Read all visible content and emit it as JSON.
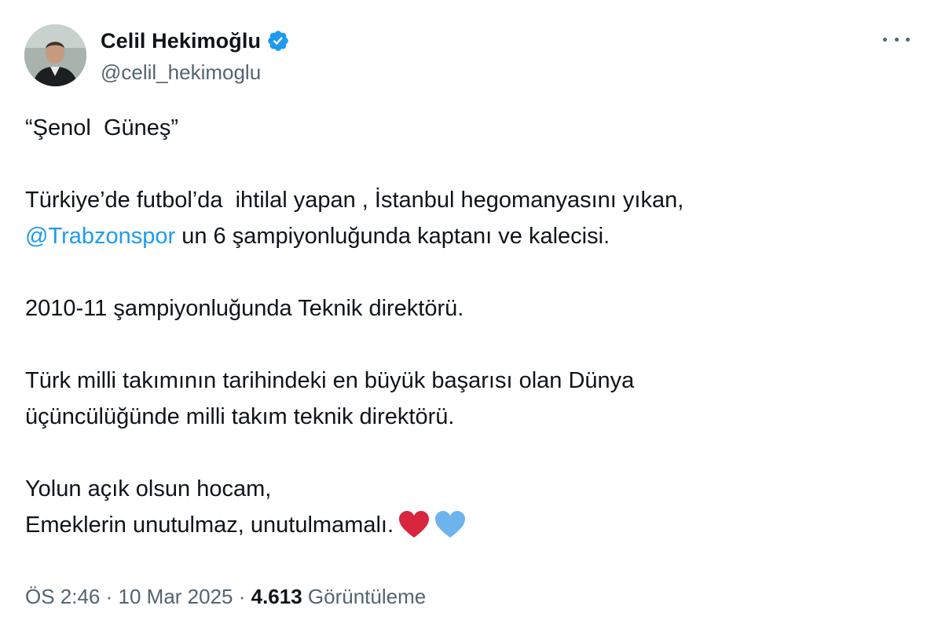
{
  "author": {
    "display_name": "Celil Hekimoğlu",
    "handle": "@celil_hekimoglu",
    "verified_color": "#1d9bf0"
  },
  "tweet": {
    "line_1": "“Şenol  Güneş”",
    "line_2": "Türkiye’de futbol’da  ihtilal yapan , İstanbul hegomanyasını yıkan,",
    "mention": "@Trabzonspor",
    "line_3_rest": " un 6 şampiyonluğunda kaptanı ve kalecisi.",
    "line_4": "2010-11 şampiyonluğunda Teknik direktörü.",
    "line_5": "Türk milli takımının tarihindeki en büyük başarısı olan Dünya",
    "line_6": "üçüncülüğünde milli takım teknik direktörü.",
    "line_7": "Yolun açık olsun hocam,",
    "line_8": "Emeklerin unutulmaz, unutulmamalı.",
    "emoji": [
      "red-heart",
      "light-blue-heart"
    ],
    "colors": {
      "mention": "#1d9bf0",
      "red_heart": "#d7263d",
      "blue_heart": "#6eb4ec"
    }
  },
  "meta": {
    "time": "ÖS 2:46",
    "separator": " · ",
    "date": "10 Mar 2025",
    "views_count": "4.613",
    "views_label": " Görüntüleme"
  }
}
